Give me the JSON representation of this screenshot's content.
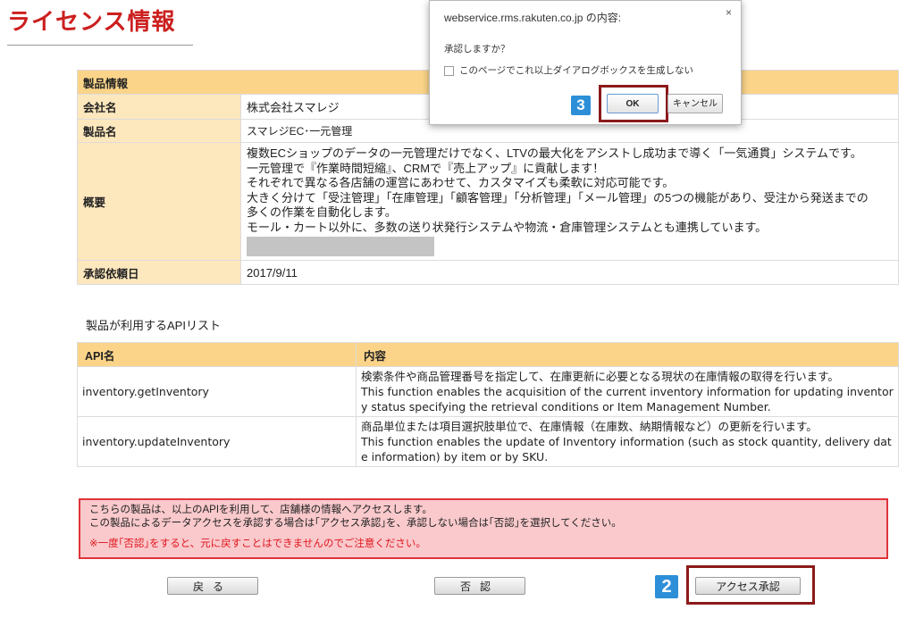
{
  "page_title": "ライセンス情報",
  "product_info": {
    "section_header": "製品情報",
    "company_label": "会社名",
    "company_value": "株式会社スマレジ",
    "product_label": "製品名",
    "product_value": "スマレジEC･一元管理",
    "overview_label": "概要",
    "overview_lines": [
      "複数ECショップのデータの一元管理だけでなく、LTVの最大化をアシストし成功まで導く「一気通貫」システムです。",
      "一元管理で『作業時間短縮』、CRMで『売上アップ』に貢献します！",
      "それぞれで異なる各店舗の運営にあわせて、カスタマイズも柔軟に対応可能です。",
      "大きく分けて「受注管理」「在庫管理」「顧客管理」「分析管理」「メール管理」の5つの機能があり、受注から発送までの",
      "多くの作業を自動化します。",
      "モール・カート以外に、多数の送り状発行システムや物流・倉庫管理システムとも連携しています。"
    ],
    "date_label": "承認依頼日",
    "date_value": "2017/9/11"
  },
  "api_list": {
    "caption": "製品が利用するAPIリスト",
    "header_name": "API名",
    "header_content": "内容",
    "rows": [
      {
        "name": "inventory.getInventory",
        "desc": [
          "検索条件や商品管理番号を指定して、在庫更新に必要となる現状の在庫情報の取得を行います。",
          "This function enables the acquisition of the current inventory information for updating inventor",
          "y status specifying the retrieval conditions or Item Management Number."
        ]
      },
      {
        "name": "inventory.updateInventory",
        "desc": [
          "商品単位または項目選択肢単位で、在庫情報（在庫数、納期情報など）の更新を行います。",
          "This function enables the update of Inventory information (such as stock quantity, delivery dat",
          "e information) by item or by SKU."
        ]
      }
    ]
  },
  "warning": {
    "line1": "こちらの製品は、以上のAPIを利用して、店舗様の情報へアクセスします。",
    "line2": "この製品によるデータアクセスを承認する場合は｢アクセス承認｣を、承認しない場合は｢否認｣を選択してください。",
    "line3": "※一度｢否認｣をすると、元に戻すことはできませんのでご注意ください。"
  },
  "buttons": {
    "back": "戻る",
    "reject": "否認",
    "approve": "アクセス承認",
    "step_approve": "2"
  },
  "dialog": {
    "title": "webservice.rms.rakuten.co.jp の内容:",
    "close": "×",
    "message": "承認しますか？",
    "checkbox_label": "このページでこれ以上ダイアログボックスを生成しない",
    "ok": "OK",
    "cancel": "キャンセル",
    "step_ok": "3"
  },
  "colors": {
    "title_red": "#cc1f1f",
    "header_orange": "#fbd489",
    "label_beige": "#fde7bd",
    "warning_bg": "#f9c9cc",
    "warning_border": "#e0333b",
    "highlight": "#8b1a1a",
    "badge_blue": "#2d8fd8"
  }
}
